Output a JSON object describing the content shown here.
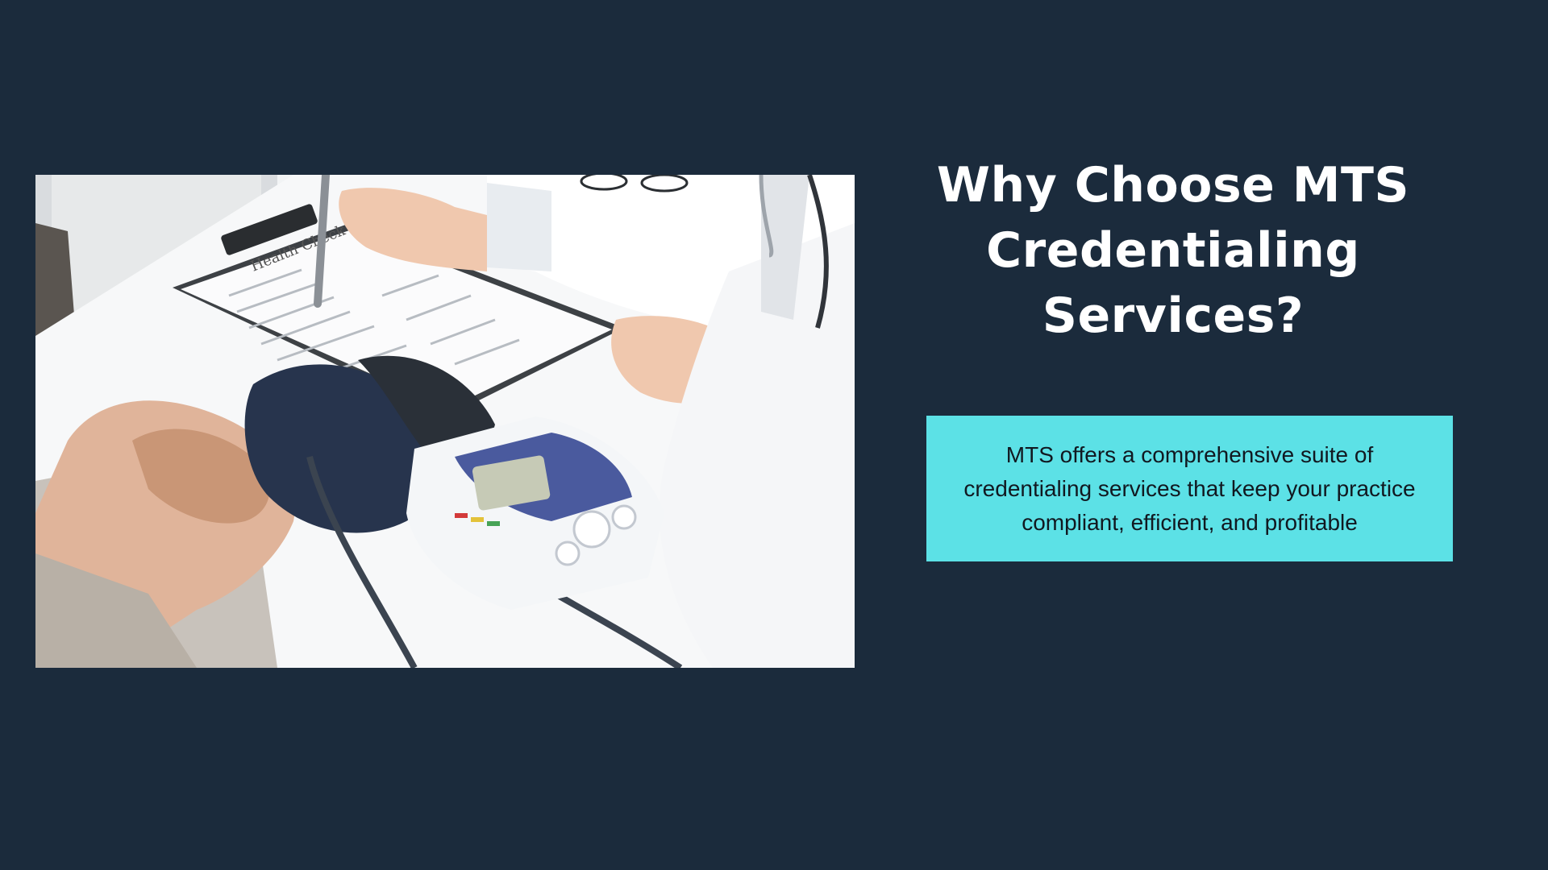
{
  "photo": {
    "alt": "doctor-writing-health-check-form-icon",
    "form_title": "Health Check"
  },
  "heading": {
    "text": "Why Choose MTS Credentialing Services?"
  },
  "info_box": {
    "text": "MTS offers a comprehensive suite of credentialing services that keep your practice compliant, efficient, and profitable"
  },
  "colors": {
    "background": "#1b2b3c",
    "heading_text": "#ffffff",
    "info_box_background": "#5ce1e6",
    "info_box_text": "#111820"
  }
}
